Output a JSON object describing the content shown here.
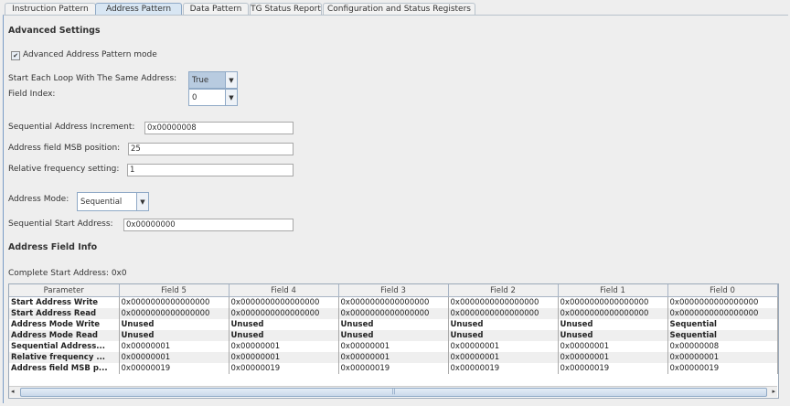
{
  "tabs": [
    {
      "label": "Instruction Pattern",
      "selected": false
    },
    {
      "label": "Address Pattern",
      "selected": true
    },
    {
      "label": "Data Pattern",
      "selected": false
    },
    {
      "label": "TG Status Report",
      "selected": false
    },
    {
      "label": "Configuration and Status Registers",
      "selected": false
    }
  ],
  "advanced": {
    "heading": "Advanced Settings",
    "mode_checkbox": {
      "label": "Advanced Address Pattern mode",
      "checked": true
    },
    "start_loop": {
      "label": "Start Each Loop With The Same Address:",
      "value": "True"
    },
    "field_index": {
      "label": "Field Index:",
      "value": "0"
    },
    "seq_inc": {
      "label": "Sequential Address Increment:",
      "value": "0x00000008"
    },
    "msb": {
      "label": "Address field MSB position:",
      "value": "25"
    },
    "rel_freq": {
      "label": "Relative frequency setting:",
      "value": "1"
    },
    "addr_mode": {
      "label": "Address Mode:",
      "value": "Sequential"
    },
    "seq_start": {
      "label": "Sequential Start Address:",
      "value": "0x00000000"
    }
  },
  "field_info": {
    "heading": "Address Field Info",
    "complete_start": "Complete Start Address: 0x0",
    "columns": [
      "Parameter",
      "Field 5",
      "Field 4",
      "Field 3",
      "Field 2",
      "Field 1",
      "Field 0"
    ],
    "rows": [
      [
        "Start Address Write",
        "0x0000000000000000",
        "0x0000000000000000",
        "0x0000000000000000",
        "0x0000000000000000",
        "0x0000000000000000",
        "0x0000000000000000"
      ],
      [
        "Start Address Read",
        "0x0000000000000000",
        "0x0000000000000000",
        "0x0000000000000000",
        "0x0000000000000000",
        "0x0000000000000000",
        "0x0000000000000000"
      ],
      [
        "Address Mode Write",
        "Unused",
        "Unused",
        "Unused",
        "Unused",
        "Unused",
        "Sequential"
      ],
      [
        "Address Mode Read",
        "Unused",
        "Unused",
        "Unused",
        "Unused",
        "Unused",
        "Sequential"
      ],
      [
        "Sequential Address...",
        "0x00000001",
        "0x00000001",
        "0x00000001",
        "0x00000001",
        "0x00000001",
        "0x00000008"
      ],
      [
        "Relative frequency ...",
        "0x00000001",
        "0x00000001",
        "0x00000001",
        "0x00000001",
        "0x00000001",
        "0x00000001"
      ],
      [
        "Address field MSB p...",
        "0x00000019",
        "0x00000019",
        "0x00000019",
        "0x00000019",
        "0x00000019",
        "0x00000019"
      ]
    ]
  }
}
